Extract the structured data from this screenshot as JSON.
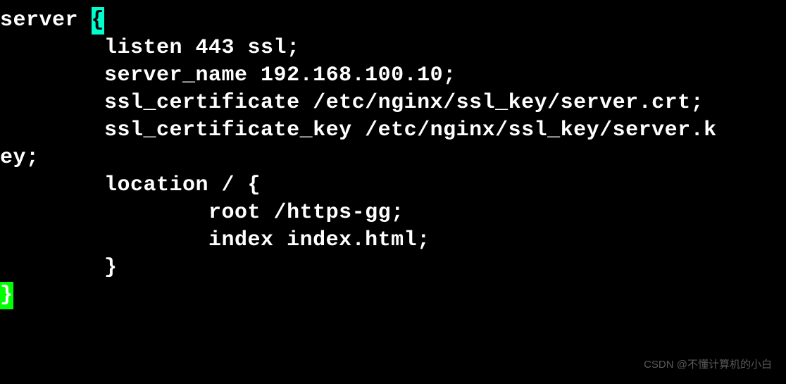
{
  "code": {
    "line1_keyword": "server ",
    "line1_brace": "{",
    "line2": "        listen 443 ssl;",
    "line3": "        server_name 192.168.100.10;",
    "line4": "        ssl_certificate /etc/nginx/ssl_key/server.crt;",
    "line5": "        ssl_certificate_key /etc/nginx/ssl_key/server.k",
    "line6": "ey;",
    "line7": "",
    "line8": "        location / {",
    "line9": "                root /https-gg;",
    "line10": "                index index.html;",
    "line11": "        }",
    "line12_brace": "}"
  },
  "watermark": "CSDN @不懂计算机的小白"
}
